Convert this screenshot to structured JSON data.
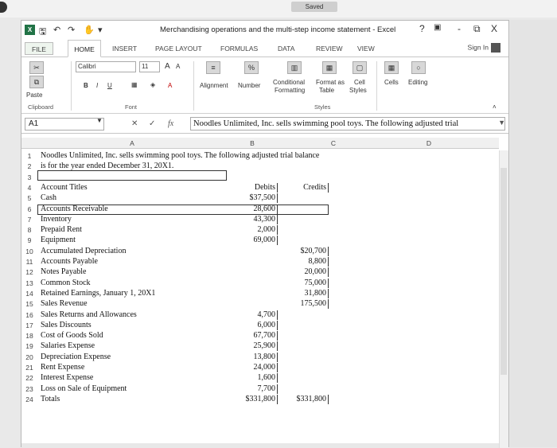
{
  "status": {
    "saved": "Saved"
  },
  "window": {
    "title": "Merchandising operations and the multi-step income statement - Excel",
    "help": "?",
    "minimize": "-",
    "restore": "&#8203;",
    "close": "X"
  },
  "tabs": {
    "file": "FILE",
    "home": "HOME",
    "insert": "INSERT",
    "page_layout": "PAGE LAYOUT",
    "formulas": "FORMULAS",
    "data": "DATA",
    "review": "REVIEW",
    "view": "VIEW",
    "signin": "Sign In"
  },
  "ribbon": {
    "font_name": "Calibri",
    "font_size": "11",
    "grow": "A",
    "shrink": "A",
    "paste": "Paste",
    "bold": "B",
    "italic": "I",
    "underline": "U",
    "font_color": "A",
    "alignment": "Alignment",
    "number": "Number",
    "percent": "%",
    "conditional": "Conditional",
    "formatting": "Formatting",
    "format_as": "Format as",
    "table": "Table",
    "cell": "Cell",
    "styles_btn": "Styles",
    "cells": "Cells",
    "editing": "Editing",
    "grp_clipboard": "Clipboard",
    "grp_font": "Font",
    "grp_styles": "Styles"
  },
  "formula_bar": {
    "namebox": "A1",
    "cancel": "✕",
    "enter": "✓",
    "fx": "fx",
    "content": "Noodles Unlimited, Inc. sells swimming pool toys. The following adjusted trial"
  },
  "columns": [
    "A",
    "B",
    "C",
    "D"
  ],
  "rows": [
    {
      "n": "1",
      "a": "Noodles Unlimited, Inc. sells swimming pool toys.  The following adjusted trial balance",
      "b": "",
      "c": ""
    },
    {
      "n": "2",
      "a": "is for the year ended December 31, 20X1.",
      "b": "",
      "c": ""
    },
    {
      "n": "3",
      "a": "",
      "b": "",
      "c": ""
    },
    {
      "n": "4",
      "a": "Account Titles",
      "b": "Debits",
      "c": "Credits"
    },
    {
      "n": "5",
      "a": "Cash",
      "b": "$37,500",
      "c": ""
    },
    {
      "n": "6",
      "a": "Accounts Receivable",
      "b": "28,600",
      "c": ""
    },
    {
      "n": "7",
      "a": "Inventory",
      "b": "43,300",
      "c": ""
    },
    {
      "n": "8",
      "a": "Prepaid Rent",
      "b": "2,000",
      "c": ""
    },
    {
      "n": "9",
      "a": "Equipment",
      "b": "69,000",
      "c": ""
    },
    {
      "n": "10",
      "a": "Accumulated Depreciation",
      "b": "",
      "c": "$20,700"
    },
    {
      "n": "11",
      "a": "Accounts Payable",
      "b": "",
      "c": "8,800"
    },
    {
      "n": "12",
      "a": "Notes Payable",
      "b": "",
      "c": "20,000"
    },
    {
      "n": "13",
      "a": "Common Stock",
      "b": "",
      "c": "75,000"
    },
    {
      "n": "14",
      "a": "Retained Earnings, January 1, 20X1",
      "b": "",
      "c": "31,800"
    },
    {
      "n": "15",
      "a": "Sales Revenue",
      "b": "",
      "c": "175,500"
    },
    {
      "n": "16",
      "a": "Sales Returns and Allowances",
      "b": "4,700",
      "c": ""
    },
    {
      "n": "17",
      "a": "Sales Discounts",
      "b": "6,000",
      "c": ""
    },
    {
      "n": "18",
      "a": "Cost of Goods Sold",
      "b": "67,700",
      "c": ""
    },
    {
      "n": "19",
      "a": "Salaries Expense",
      "b": "25,900",
      "c": ""
    },
    {
      "n": "20",
      "a": "Depreciation Expense",
      "b": "13,800",
      "c": ""
    },
    {
      "n": "21",
      "a": "Rent Expense",
      "b": "24,000",
      "c": ""
    },
    {
      "n": "22",
      "a": "Interest Expense",
      "b": "1,600",
      "c": ""
    },
    {
      "n": "23",
      "a": "Loss on Sale of Equipment",
      "b": "7,700",
      "c": ""
    },
    {
      "n": "24",
      "a": "Totals",
      "b": "$331,800",
      "c": "$331,800"
    }
  ]
}
